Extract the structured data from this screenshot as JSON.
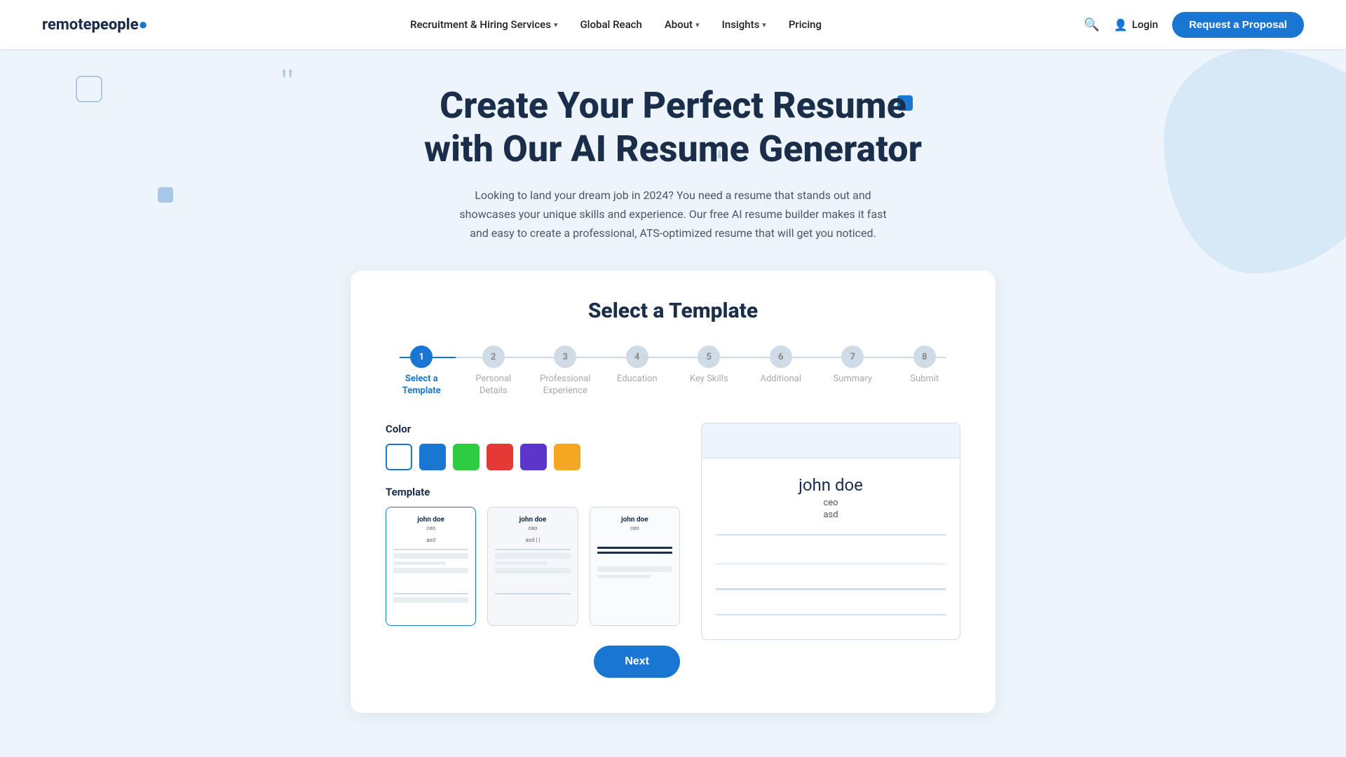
{
  "brand": {
    "name_part1": "remote",
    "name_part2": "people",
    "dot": "●"
  },
  "nav": {
    "links": [
      {
        "label": "Recruitment & Hiring Services",
        "has_dropdown": true
      },
      {
        "label": "Global Reach",
        "has_dropdown": false
      },
      {
        "label": "About",
        "has_dropdown": true
      },
      {
        "label": "Insights",
        "has_dropdown": true
      },
      {
        "label": "Pricing",
        "has_dropdown": false
      }
    ],
    "login_label": "Login",
    "request_btn_label": "Request a Proposal"
  },
  "hero": {
    "title": "Create Your Perfect Resume with Our AI Resume Generator",
    "subtitle": "Looking to land your dream job in 2024? You need a resume that stands out and showcases your unique skills and experience. Our free AI resume builder makes it fast and easy to create a professional, ATS-optimized resume that will get you noticed."
  },
  "card": {
    "title": "Select a Template",
    "steps": [
      {
        "num": "1",
        "label": "Select a\nTemplate",
        "active": true
      },
      {
        "num": "2",
        "label": "Personal\nDetails",
        "active": false
      },
      {
        "num": "3",
        "label": "Professional\nExperience",
        "active": false
      },
      {
        "num": "4",
        "label": "Education",
        "active": false
      },
      {
        "num": "5",
        "label": "Key Skills",
        "active": false
      },
      {
        "num": "6",
        "label": "Additional",
        "active": false
      },
      {
        "num": "7",
        "label": "Summary",
        "active": false
      },
      {
        "num": "8",
        "label": "Submit",
        "active": false
      }
    ],
    "color_label": "Color",
    "template_label": "Template",
    "swatches": [
      {
        "id": "white",
        "css_class": "swatch-white",
        "selected": true
      },
      {
        "id": "blue",
        "css_class": "swatch-blue",
        "selected": false
      },
      {
        "id": "green",
        "css_class": "swatch-green",
        "selected": false
      },
      {
        "id": "red",
        "css_class": "swatch-red",
        "selected": false
      },
      {
        "id": "purple",
        "css_class": "swatch-purple",
        "selected": false
      },
      {
        "id": "orange",
        "css_class": "swatch-orange",
        "selected": false
      }
    ],
    "templates": [
      {
        "id": "tpl1",
        "name": "john doe",
        "role": "ceo",
        "company": "asd",
        "active": true
      },
      {
        "id": "tpl2",
        "name": "john doe",
        "role": "ceo",
        "company": "asd | |",
        "active": false
      },
      {
        "id": "tpl3",
        "name": "john doe",
        "role": "ceo",
        "company": "",
        "active": false
      }
    ],
    "preview": {
      "name": "john doe",
      "role": "ceo",
      "company": "asd"
    },
    "next_btn_label": "Next"
  }
}
